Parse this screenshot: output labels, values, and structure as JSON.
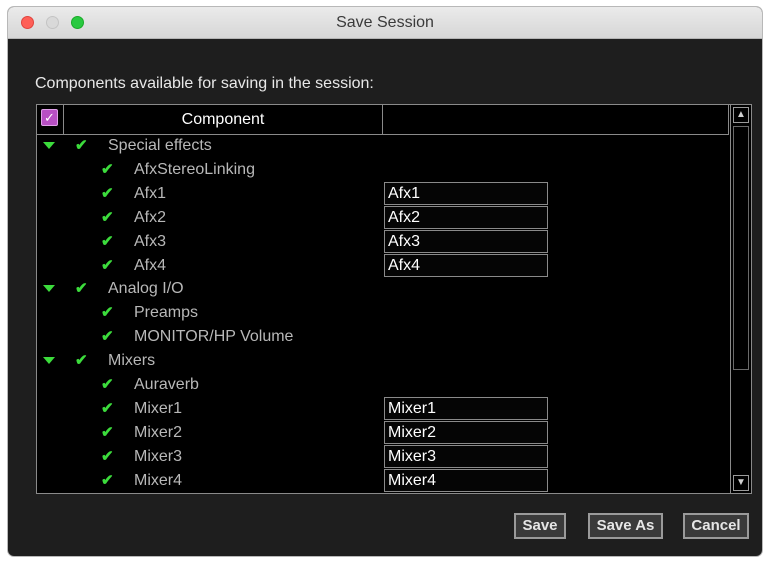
{
  "window": {
    "title": "Save Session"
  },
  "dialog": {
    "heading": "Components available for saving in the session:"
  },
  "table": {
    "header": {
      "component": "Component",
      "check_mark": "✓"
    },
    "rows": [
      {
        "label": "Special effects",
        "level": 0
      },
      {
        "label": "AfxStereoLinking",
        "level": 1
      },
      {
        "label": "Afx1",
        "level": 1,
        "name": "Afx1"
      },
      {
        "label": "Afx2",
        "level": 1,
        "name": "Afx2"
      },
      {
        "label": "Afx3",
        "level": 1,
        "name": "Afx3"
      },
      {
        "label": "Afx4",
        "level": 1,
        "name": "Afx4"
      },
      {
        "label": "Analog I/O",
        "level": 0
      },
      {
        "label": "Preamps",
        "level": 1
      },
      {
        "label": "MONITOR/HP Volume",
        "level": 1
      },
      {
        "label": "Mixers",
        "level": 0
      },
      {
        "label": "Auraverb",
        "level": 1
      },
      {
        "label": "Mixer1",
        "level": 1,
        "name": "Mixer1"
      },
      {
        "label": "Mixer2",
        "level": 1,
        "name": "Mixer2"
      },
      {
        "label": "Mixer3",
        "level": 1,
        "name": "Mixer3"
      },
      {
        "label": "Mixer4",
        "level": 1,
        "name": "Mixer4"
      }
    ],
    "check_glyph": "✔",
    "scroll_up_glyph": "▲",
    "scroll_down_glyph": "▼"
  },
  "buttons": {
    "save": "Save",
    "save_as": "Save As",
    "cancel": "Cancel"
  },
  "colors": {
    "check_green": "#3cdc3c",
    "header_checkbox": "#b84fc4"
  }
}
